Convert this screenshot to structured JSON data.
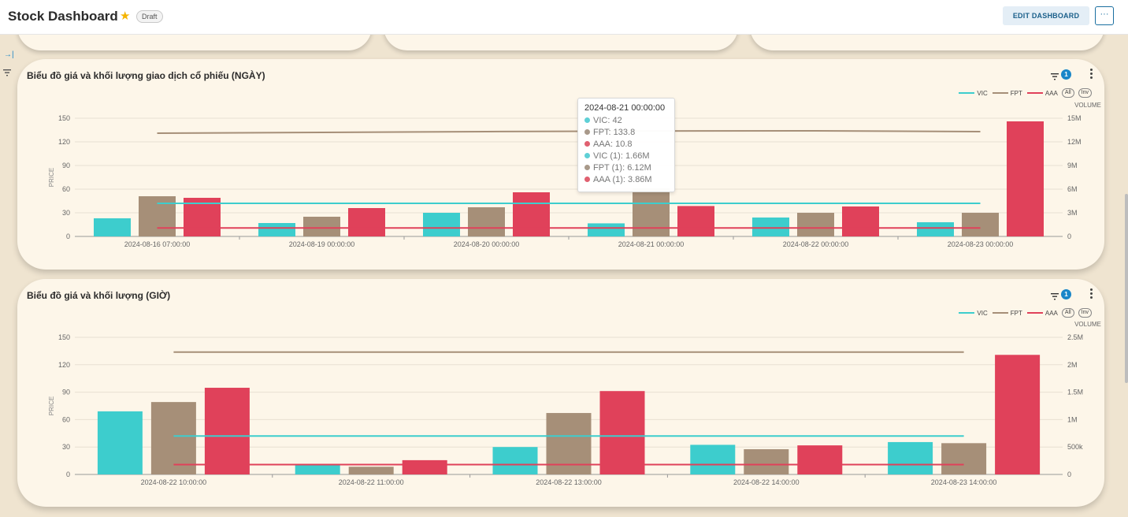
{
  "header": {
    "title": "Stock Dashboard",
    "badge": "Draft",
    "edit_label": "EDIT DASHBOARD",
    "more_label": "···"
  },
  "colors": {
    "VIC": "#3dcdcd",
    "FPT": "#a68f78",
    "AAA": "#e0415a",
    "accent": "#1a86c8"
  },
  "charts": [
    {
      "title": "Biểu đồ giá và khối lượng giao dịch cổ phiếu (NGÀY)",
      "filter_count": "1",
      "legend": {
        "series": [
          "VIC",
          "FPT",
          "AAA"
        ],
        "all_label": "All",
        "inv_label": "Inv"
      },
      "y_left_label": "PRICE",
      "y_right_label": "VOLUME"
    },
    {
      "title": "Biểu đồ giá và khối lượng (GIỜ)",
      "filter_count": "1",
      "legend": {
        "series": [
          "VIC",
          "FPT",
          "AAA"
        ],
        "all_label": "All",
        "inv_label": "Inv"
      },
      "y_left_label": "PRICE",
      "y_right_label": "VOLUME"
    }
  ],
  "chart_data": [
    {
      "type": "bar",
      "title": "Biểu đồ giá và khối lượng giao dịch cổ phiếu (NGÀY)",
      "categories": [
        "2024-08-16 07:00:00",
        "2024-08-19 00:00:00",
        "2024-08-20 00:00:00",
        "2024-08-21 00:00:00",
        "2024-08-22 00:00:00",
        "2024-08-23 00:00:00"
      ],
      "ylabel": "PRICE",
      "y2label": "VOLUME",
      "ylim": [
        0,
        150
      ],
      "y2lim": [
        0,
        15000000
      ],
      "y_ticks": [
        "0",
        "30",
        "60",
        "90",
        "120",
        "150"
      ],
      "y2_ticks": [
        "0",
        "3M",
        "6M",
        "9M",
        "12M",
        "15M"
      ],
      "volume_series": [
        {
          "name": "VIC (1)",
          "values": [
            2300000,
            1700000,
            3000000,
            1660000,
            2400000,
            1800000
          ]
        },
        {
          "name": "FPT (1)",
          "values": [
            5100000,
            2500000,
            3700000,
            6120000,
            3000000,
            3000000
          ]
        },
        {
          "name": "AAA (1)",
          "values": [
            4900000,
            3600000,
            5600000,
            3860000,
            3800000,
            14600000
          ]
        }
      ],
      "price_series": [
        {
          "name": "VIC",
          "values": [
            42,
            42,
            42,
            42,
            42,
            42
          ]
        },
        {
          "name": "FPT",
          "values": [
            131,
            132,
            133,
            133.8,
            134,
            133
          ]
        },
        {
          "name": "AAA",
          "values": [
            10.8,
            10.8,
            10.8,
            10.8,
            10.8,
            10.8
          ]
        }
      ],
      "legend_position": "top-right",
      "grid": true
    },
    {
      "type": "bar",
      "title": "Biểu đồ giá và khối lượng (GIỜ)",
      "categories": [
        "2024-08-22 10:00:00",
        "2024-08-22 11:00:00",
        "2024-08-22 13:00:00",
        "2024-08-22 14:00:00",
        "2024-08-23 14:00:00"
      ],
      "ylabel": "PRICE",
      "y2label": "VOLUME",
      "ylim": [
        0,
        150
      ],
      "y2lim": [
        0,
        2500000
      ],
      "y_ticks": [
        "0",
        "30",
        "60",
        "90",
        "120",
        "150"
      ],
      "y2_ticks": [
        "0",
        "500k",
        "1M",
        "1.5M",
        "2M",
        "2.5M"
      ],
      "volume_series": [
        {
          "name": "VIC (1)",
          "values": [
            1150000,
            180000,
            500000,
            540000,
            590000
          ]
        },
        {
          "name": "FPT (1)",
          "values": [
            1320000,
            140000,
            1120000,
            460000,
            570000
          ]
        },
        {
          "name": "AAA (1)",
          "values": [
            1580000,
            260000,
            1520000,
            530000,
            2180000
          ]
        }
      ],
      "price_series": [
        {
          "name": "VIC",
          "values": [
            42,
            42,
            42,
            42,
            42
          ]
        },
        {
          "name": "FPT",
          "values": [
            133.8,
            133.8,
            133.8,
            133.8,
            133.8
          ]
        },
        {
          "name": "AAA",
          "values": [
            10.8,
            10.8,
            10.8,
            10.8,
            10.8
          ]
        }
      ],
      "legend_position": "top-right",
      "grid": true
    }
  ],
  "tooltip": {
    "title": "2024-08-21 00:00:00",
    "rows": [
      {
        "text": "VIC: 42",
        "color": "#5fd0d6"
      },
      {
        "text": "FPT: 133.8",
        "color": "#a8998a"
      },
      {
        "text": "AAA: 10.8",
        "color": "#e06070"
      },
      {
        "text": "VIC (1): 1.66M",
        "color": "#5fd0d6"
      },
      {
        "text": "FPT (1): 6.12M",
        "color": "#a8998a"
      },
      {
        "text": "AAA (1): 3.86M",
        "color": "#e06070"
      }
    ]
  }
}
